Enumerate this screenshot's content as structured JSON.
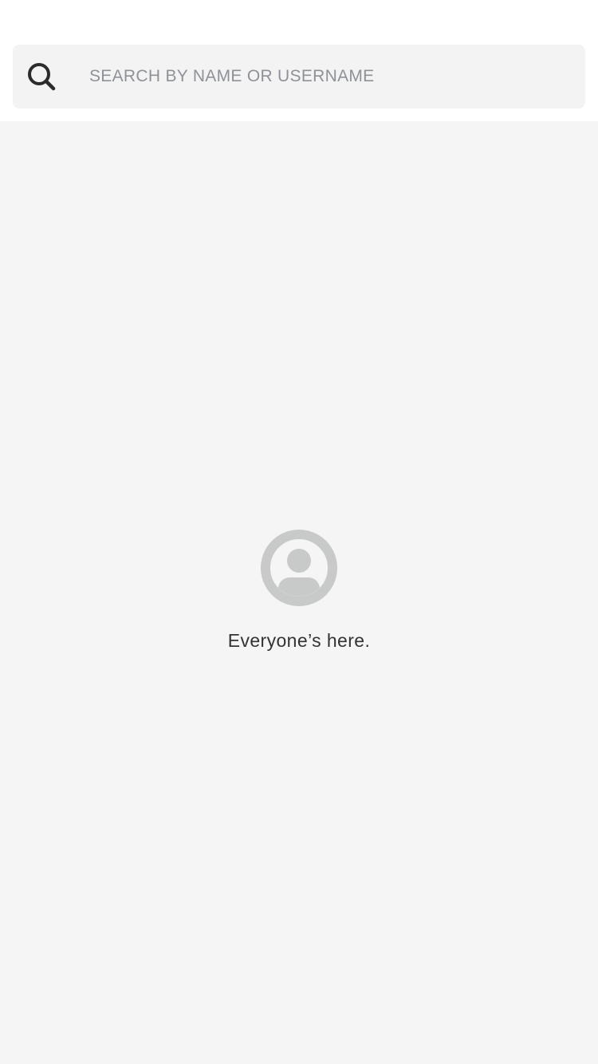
{
  "search": {
    "placeholder": "SEARCH BY NAME OR USERNAME",
    "value": "",
    "icon": "search-icon"
  },
  "empty_state": {
    "icon": "user-avatar-icon",
    "message": "Everyone’s here."
  },
  "colors": {
    "header_bg": "#ffffff",
    "search_box_bg": "#f3f3f3",
    "placeholder_text": "#8e9298",
    "content_bg": "#f5f5f5",
    "avatar_gray": "#c8c9c9",
    "message_text": "#333333",
    "search_icon": "#2b2b2b"
  }
}
